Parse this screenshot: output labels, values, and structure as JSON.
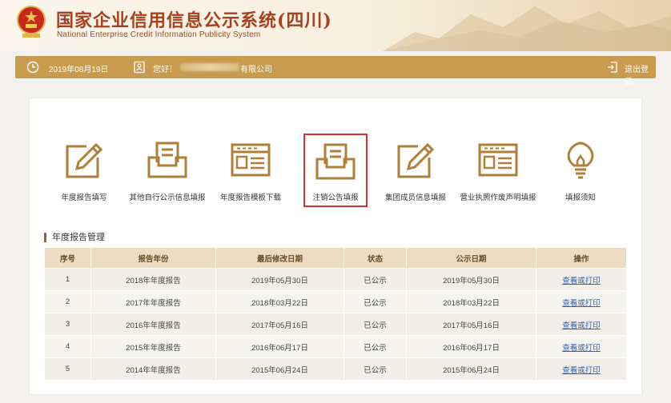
{
  "header": {
    "title": "国家企业信用信息公示系统(四川)",
    "subtitle": "National Enterprise Credit Information Publicity System"
  },
  "infobar": {
    "date": "2019年08月19日",
    "greeting": "您好！",
    "company_suffix": "有限公司",
    "logout": "退出登录"
  },
  "functions": [
    {
      "label": "年度报告填写",
      "icon": "pen-edit-icon"
    },
    {
      "label": "其他自行公示信息填报",
      "icon": "inbox-document-icon"
    },
    {
      "label": "年度报告模板下载",
      "icon": "browser-document-icon"
    },
    {
      "label": "注销公告填报",
      "icon": "inbox-document-icon"
    },
    {
      "label": "集团成员信息填报",
      "icon": "pen-edit-icon"
    },
    {
      "label": "营业执照作废声明填报",
      "icon": "browser-document-icon"
    },
    {
      "label": "填报须知",
      "icon": "lightbulb-icon"
    }
  ],
  "section_title": "年度报告管理",
  "table": {
    "headers": [
      "序号",
      "报告年份",
      "最后修改日期",
      "状态",
      "公示日期",
      "操作"
    ],
    "rows": [
      [
        "1",
        "2018年年度报告",
        "2019年05月30日",
        "已公示",
        "2019年05月30日",
        "查看或打印"
      ],
      [
        "2",
        "2017年年度报告",
        "2018年03月22日",
        "已公示",
        "2018年03月22日",
        "查看或打印"
      ],
      [
        "3",
        "2016年年度报告",
        "2017年05月16日",
        "已公示",
        "2017年05月16日",
        "查看或打印"
      ],
      [
        "4",
        "2015年年度报告",
        "2016年06月17日",
        "已公示",
        "2016年06月17日",
        "查看或打印"
      ],
      [
        "5",
        "2014年年度报告",
        "2015年06月24日",
        "已公示",
        "2015年06月24日",
        "查看或打印"
      ]
    ]
  },
  "colors": {
    "accent": "#c89b4e",
    "icon": "#b07f3a",
    "title": "#a8401e",
    "highlight_border": "#d9302b",
    "link": "#2c5fb8"
  }
}
